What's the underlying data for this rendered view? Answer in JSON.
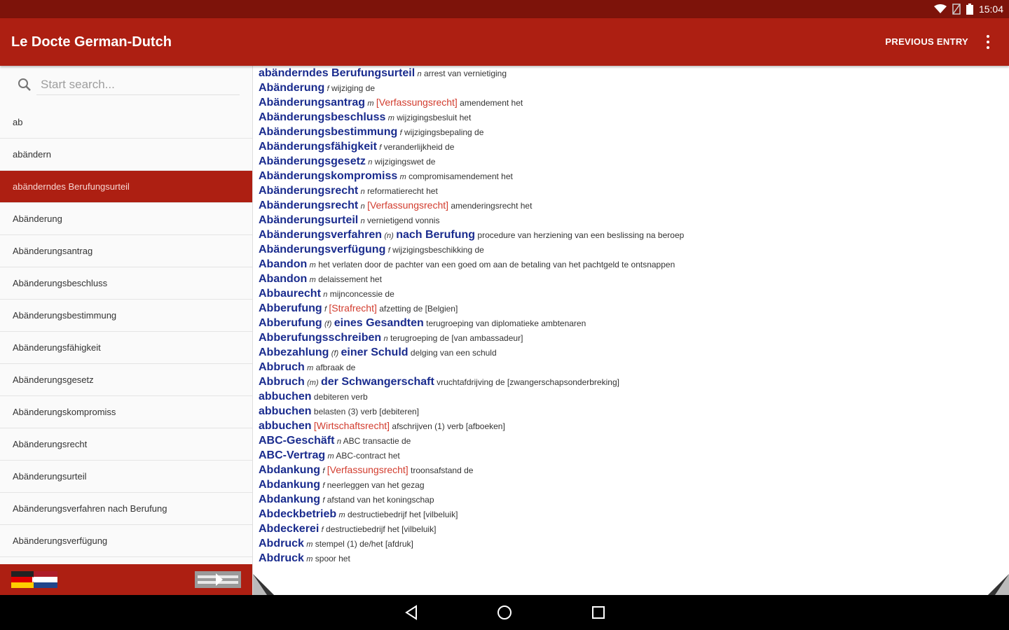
{
  "status": {
    "time": "15:04"
  },
  "app": {
    "title": "Le Docte German-Dutch",
    "previous_entry": "PREVIOUS ENTRY"
  },
  "search": {
    "placeholder": "Start search..."
  },
  "wordlist": [
    "ab",
    "abändern",
    "abänderndes Berufungsurteil",
    "Abänderung",
    "Abänderungsantrag",
    "Abänderungsbeschluss",
    "Abänderungsbestimmung",
    "Abänderungsfähigkeit",
    "Abänderungsgesetz",
    "Abänderungskompromiss",
    "Abänderungsrecht",
    "Abänderungsurteil",
    "Abänderungsverfahren nach Berufung",
    "Abänderungsverfügung"
  ],
  "selected_index": 2,
  "entries": [
    {
      "hw": "abänderndes Berufungsurteil",
      "gram": "n",
      "field": "",
      "tr": "arrest van vernietiging"
    },
    {
      "hw": "Abänderung",
      "gram": "f",
      "field": "",
      "tr": "wijziging de"
    },
    {
      "hw": "Abänderungsantrag",
      "gram": "m",
      "field": "[Verfassungsrecht]",
      "tr": "amendement het"
    },
    {
      "hw": "Abänderungsbeschluss",
      "gram": "m",
      "field": "",
      "tr": "wijzigingsbesluit het"
    },
    {
      "hw": "Abänderungsbestimmung",
      "gram": "f",
      "field": "",
      "tr": "wijzigingsbepaling de"
    },
    {
      "hw": "Abänderungsfähigkeit",
      "gram": "f",
      "field": "",
      "tr": "veranderlijkheid de"
    },
    {
      "hw": "Abänderungsgesetz",
      "gram": "n",
      "field": "",
      "tr": "wijzigingswet de"
    },
    {
      "hw": "Abänderungskompromiss",
      "gram": "m",
      "field": "",
      "tr": "compromisamendement het"
    },
    {
      "hw": "Abänderungsrecht",
      "gram": "n",
      "field": "",
      "tr": "reformatierecht het"
    },
    {
      "hw": "Abänderungsrecht",
      "gram": "n",
      "field": "[Verfassungsrecht]",
      "tr": "amenderingsrecht het"
    },
    {
      "hw": "Abänderungsurteil",
      "gram": "n",
      "field": "",
      "tr": "vernietigend vonnis"
    },
    {
      "hw": "Abänderungsverfahren",
      "gram": "(n)",
      "hw2": "nach Berufung",
      "field": "",
      "tr": "procedure van herziening van een beslissing na beroep"
    },
    {
      "hw": "Abänderungsverfügung",
      "gram": "f",
      "field": "",
      "tr": "wijzigingsbeschikking de"
    },
    {
      "hw": "Abandon",
      "gram": "m",
      "field": "",
      "tr": "het verlaten door de pachter van een goed om aan de betaling van het pachtgeld te ontsnappen"
    },
    {
      "hw": "Abandon",
      "gram": "m",
      "field": "",
      "tr": "delaissement het"
    },
    {
      "hw": "Abbaurecht",
      "gram": "n",
      "field": "",
      "tr": "mijnconcessie de"
    },
    {
      "hw": "Abberufung",
      "gram": "f",
      "field": "[Strafrecht]",
      "tr": "afzetting de [Belgien]"
    },
    {
      "hw": "Abberufung",
      "gram": "(f)",
      "hw2": "eines Gesandten",
      "field": "",
      "tr": "terugroeping van diplomatieke ambtenaren"
    },
    {
      "hw": "Abberufungsschreiben",
      "gram": "n",
      "field": "",
      "tr": "terugroeping de [van ambassadeur]"
    },
    {
      "hw": "Abbezahlung",
      "gram": "(f)",
      "hw2": "einer Schuld",
      "field": "",
      "tr": "delging van een schuld"
    },
    {
      "hw": "Abbruch",
      "gram": "m",
      "field": "",
      "tr": "afbraak de"
    },
    {
      "hw": "Abbruch",
      "gram": "(m)",
      "hw2": "der Schwangerschaft",
      "field": "",
      "tr": "vruchtafdrijving de [zwangerschapsonderbreking]"
    },
    {
      "hw": "abbuchen",
      "gram": "",
      "field": "",
      "tr": "debiteren verb"
    },
    {
      "hw": "abbuchen",
      "gram": "",
      "field": "",
      "tr": "belasten (3) verb [debiteren]"
    },
    {
      "hw": "abbuchen",
      "gram": "",
      "field": "[Wirtschaftsrecht]",
      "tr": "afschrijven (1) verb [afboeken]"
    },
    {
      "hw": "ABC-Geschäft",
      "gram": "n",
      "field": "",
      "tr": "ABC transactie de"
    },
    {
      "hw": "ABC-Vertrag",
      "gram": "m",
      "field": "",
      "tr": "ABC-contract het"
    },
    {
      "hw": "Abdankung",
      "gram": "f",
      "field": "[Verfassungsrecht]",
      "tr": "troonsafstand de"
    },
    {
      "hw": "Abdankung",
      "gram": "f",
      "field": "",
      "tr": "neerleggen van het gezag"
    },
    {
      "hw": "Abdankung",
      "gram": "f",
      "field": "",
      "tr": "afstand van het koningschap"
    },
    {
      "hw": "Abdeckbetrieb",
      "gram": "m",
      "field": "",
      "tr": "destructiebedrijf het [vilbeluik]"
    },
    {
      "hw": "Abdeckerei",
      "gram": "f",
      "field": "",
      "tr": "destructiebedrijf het [vilbeluik]"
    },
    {
      "hw": "Abdruck",
      "gram": "m",
      "field": "",
      "tr": "stempel (1) de/het [afdruk]"
    },
    {
      "hw": "Abdruck",
      "gram": "m",
      "field": "",
      "tr": "spoor het"
    }
  ]
}
